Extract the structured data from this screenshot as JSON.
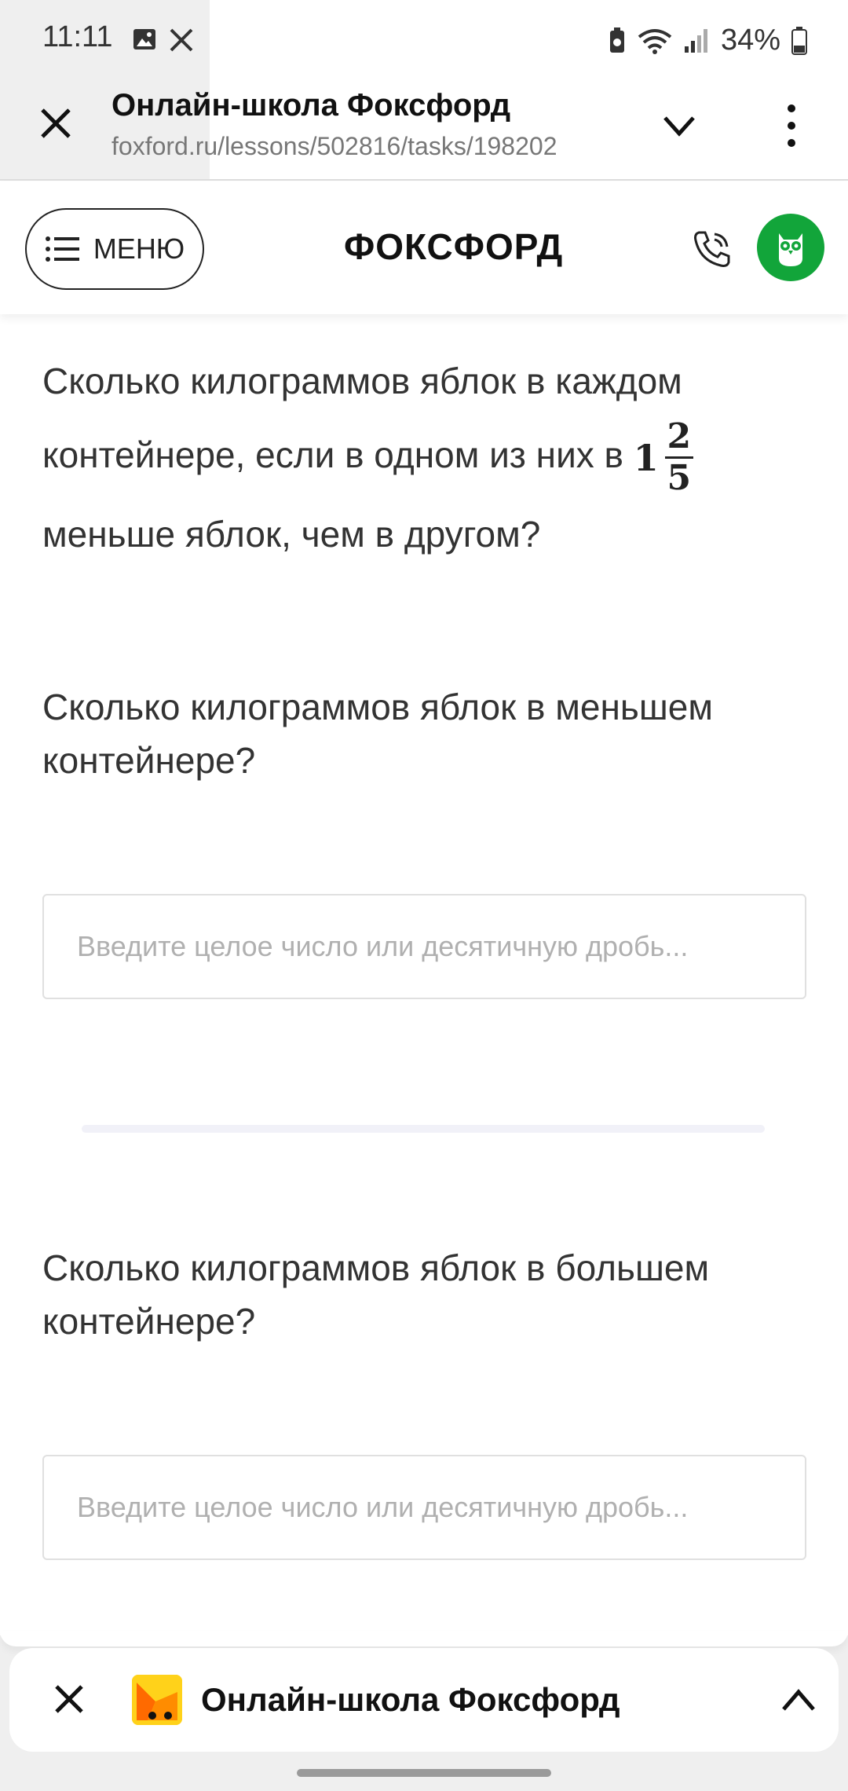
{
  "status": {
    "time": "11:11",
    "battery": "34%",
    "icons_left": [
      "image-icon",
      "tools-icon"
    ],
    "icons_right": [
      "battery-saver-icon",
      "wifi-icon",
      "signal-icon",
      "battery-icon"
    ]
  },
  "browser": {
    "title": "Онлайн-школа Фоксфорд",
    "url": "foxford.ru/lessons/502816/tasks/198202"
  },
  "site": {
    "menu_label": "МЕНЮ",
    "logo": "ФОКСФОРД",
    "brand_color": "#12a53a"
  },
  "question": {
    "part1": "Сколько килограммов яблок в каждом контейнере, если в одном из них в ",
    "fraction_whole": "1",
    "fraction_num": "2",
    "fraction_den": "5",
    "part2": "меньше яблок, чем в другом?"
  },
  "subquestions": [
    {
      "text": "Сколько килограммов яблок в меньшем контейнере?",
      "placeholder": "Введите целое число или десятичную дробь...",
      "value": ""
    },
    {
      "text": "Сколько килограммов яблок в большем контейнере?",
      "placeholder": "Введите целое число или десятичную дробь...",
      "value": ""
    }
  ],
  "bottom_bar": {
    "title": "Онлайн-школа Фоксфорд"
  }
}
